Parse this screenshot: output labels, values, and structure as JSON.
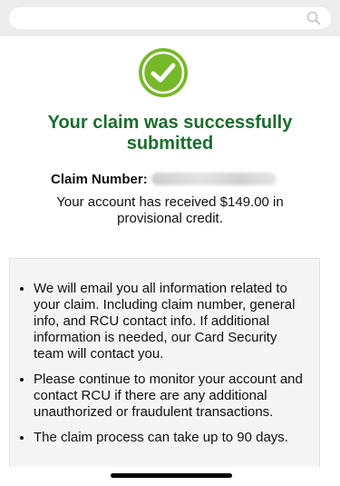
{
  "search": {
    "icon": "search-icon"
  },
  "status": {
    "icon": "check-circle-icon",
    "color": "#77b82a"
  },
  "title": "Your claim was successfully submitted",
  "claim": {
    "label": "Claim Number:",
    "value_redacted": true
  },
  "credit_message": "Your account has received $149.00 in provisional credit.",
  "info": {
    "items": [
      "We will email you all information related to your claim. Including claim number, general info, and RCU contact info. If additional information is needed, our Card Security team will contact you.",
      "Please continue to monitor your account and contact RCU if there are any additional unauthorized or fraudulent transactions.",
      "The claim process can take up to 90 days."
    ]
  },
  "colors": {
    "title": "#1a6e2e",
    "check": "#77b82a"
  }
}
